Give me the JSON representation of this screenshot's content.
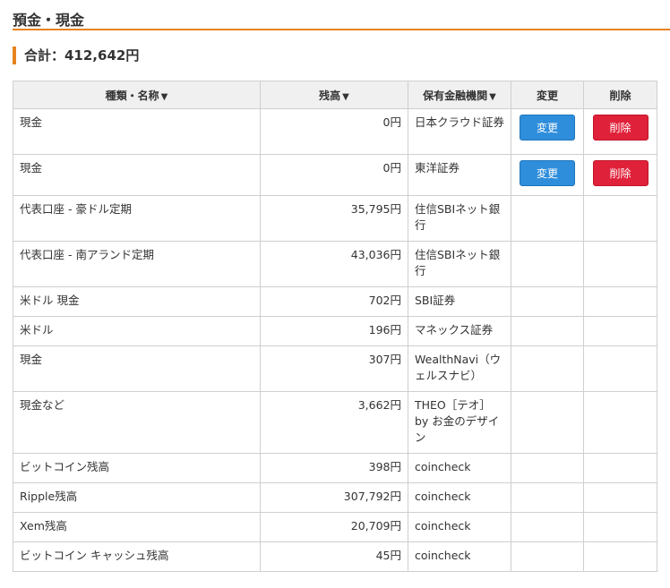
{
  "section": {
    "title": "預金・現金"
  },
  "total": {
    "label": "合計：412,642円"
  },
  "table": {
    "headers": {
      "name": "種類・名称",
      "balance": "残高",
      "institution": "保有金融機関",
      "edit": "変更",
      "delete": "削除"
    },
    "sort_caret": "▼",
    "edit_label": "変更",
    "delete_label": "削除",
    "rows": [
      {
        "name": "現金",
        "amount": "0円",
        "institution": "日本クラウド証券",
        "editable": true
      },
      {
        "name": "現金",
        "amount": "0円",
        "institution": "東洋証券",
        "editable": true
      },
      {
        "name": "代表口座 - 豪ドル定期",
        "amount": "35,795円",
        "institution": "住信SBIネット銀行",
        "editable": false
      },
      {
        "name": "代表口座 - 南アランド定期",
        "amount": "43,036円",
        "institution": "住信SBIネット銀行",
        "editable": false
      },
      {
        "name": "米ドル 現金",
        "amount": "702円",
        "institution": "SBI証券",
        "editable": false
      },
      {
        "name": "米ドル",
        "amount": "196円",
        "institution": "マネックス証券",
        "editable": false
      },
      {
        "name": "現金",
        "amount": "307円",
        "institution": "WealthNavi（ウェルスナビ）",
        "editable": false
      },
      {
        "name": "現金など",
        "amount": "3,662円",
        "institution": "THEO［テオ］by お金のデザイン",
        "editable": false
      },
      {
        "name": "ビットコイン残高",
        "amount": "398円",
        "institution": "coincheck",
        "editable": false
      },
      {
        "name": "Ripple残高",
        "amount": "307,792円",
        "institution": "coincheck",
        "editable": false
      },
      {
        "name": "Xem残高",
        "amount": "20,709円",
        "institution": "coincheck",
        "editable": false
      },
      {
        "name": "ビットコイン キャッシュ残高",
        "amount": "45円",
        "institution": "coincheck",
        "editable": false
      }
    ]
  },
  "colors": {
    "accent": "#e8821e",
    "edit_button": "#2f8edb",
    "delete_button": "#e0213a",
    "header_bg": "#f0f0f0"
  }
}
